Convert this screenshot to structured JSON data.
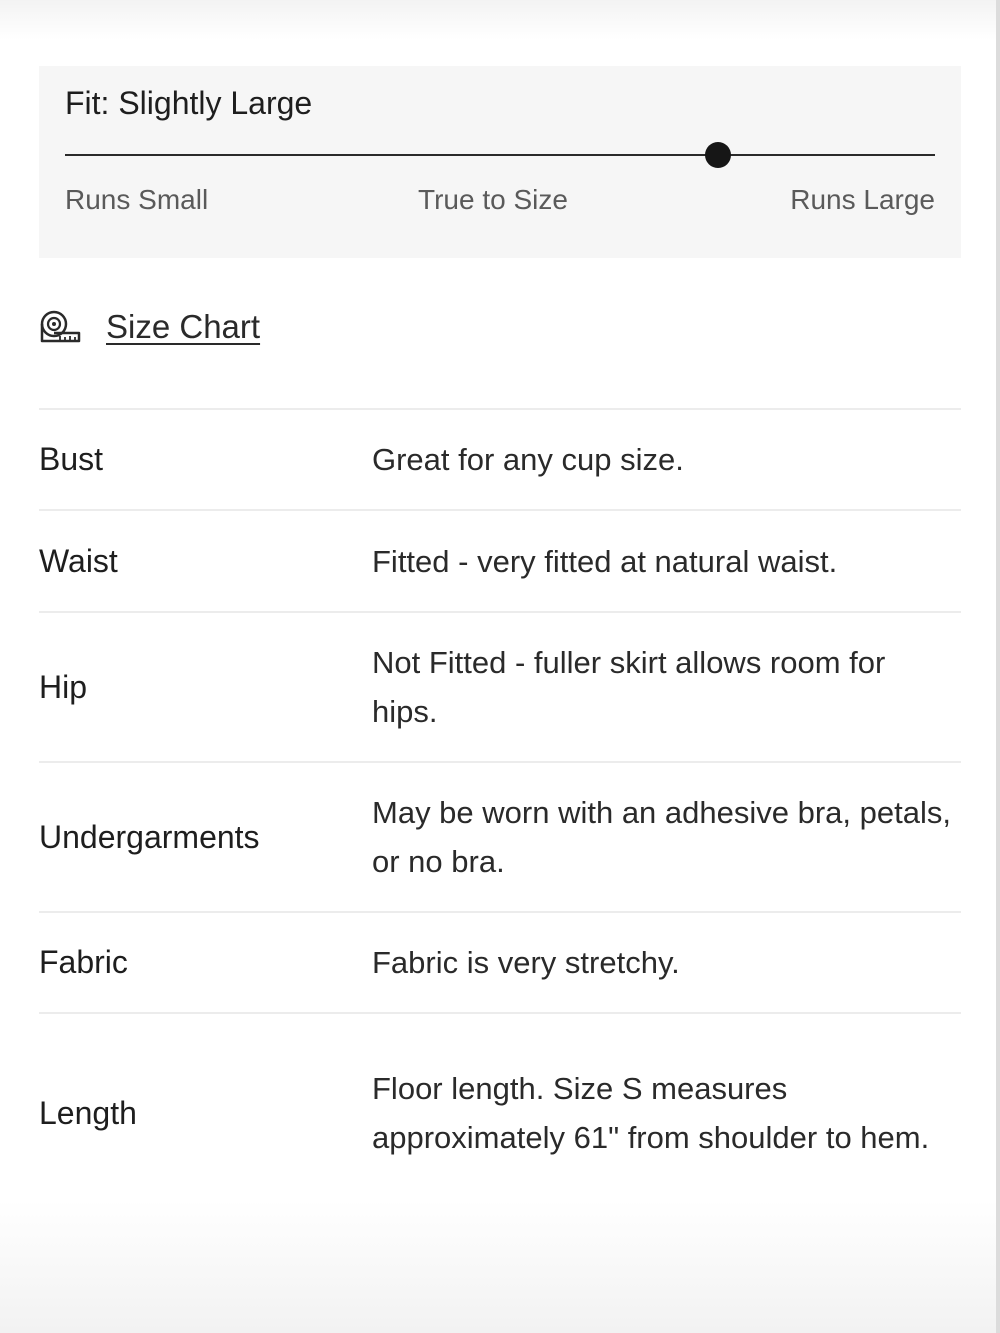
{
  "fit": {
    "title": "Fit: Slightly Large",
    "scale_value": 0.75,
    "labels": [
      "Runs Small",
      "True to Size",
      "Runs Large"
    ]
  },
  "size_chart": {
    "icon": "measuring-tape-icon",
    "label": "Size Chart"
  },
  "details": [
    {
      "label": "Bust",
      "value": "Great for any cup size."
    },
    {
      "label": "Waist",
      "value": "Fitted - very fitted at natural waist."
    },
    {
      "label": "Hip",
      "value": "Not Fitted - fuller skirt allows room for hips."
    },
    {
      "label": "Undergarments",
      "value": "May be worn with an adhesive bra, petals, or no bra."
    },
    {
      "label": "Fabric",
      "value": "Fabric is very stretchy."
    },
    {
      "label": "Length",
      "value": "Floor length. Size S measures approximately 61\" from shoulder to hem."
    }
  ],
  "colors": {
    "panel_bg": "#f6f6f6",
    "track": "#2a2a2a",
    "thumb": "#161616",
    "divider": "#ececec"
  }
}
